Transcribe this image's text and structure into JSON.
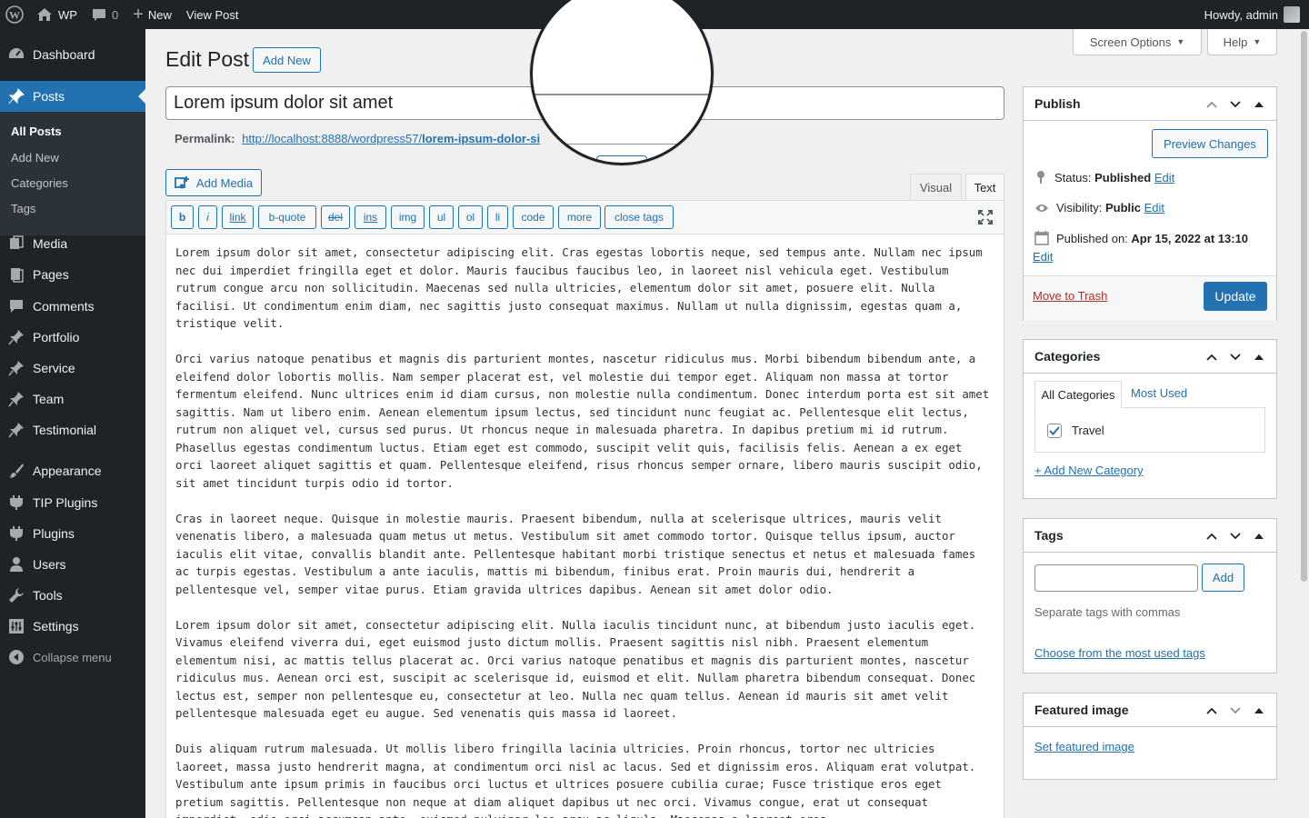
{
  "adminbar": {
    "site_name": "WP",
    "comments_count": "0",
    "new_label": "New",
    "view_post_label": "View Post",
    "howdy": "Howdy, admin"
  },
  "sidebar": {
    "items": [
      {
        "label": "Dashboard",
        "icon": "dashboard-icon"
      },
      {
        "label": "Posts",
        "icon": "pin-icon"
      },
      {
        "label": "Media",
        "icon": "media-icon"
      },
      {
        "label": "Pages",
        "icon": "pages-icon"
      },
      {
        "label": "Comments",
        "icon": "comments-icon"
      },
      {
        "label": "Portfolio",
        "icon": "pin-icon"
      },
      {
        "label": "Service",
        "icon": "pin-icon"
      },
      {
        "label": "Team",
        "icon": "pin-icon"
      },
      {
        "label": "Testimonial",
        "icon": "pin-icon"
      },
      {
        "label": "Appearance",
        "icon": "brush-icon"
      },
      {
        "label": "TIP Plugins",
        "icon": "plugin-icon"
      },
      {
        "label": "Plugins",
        "icon": "plugin-icon"
      },
      {
        "label": "Users",
        "icon": "users-icon"
      },
      {
        "label": "Tools",
        "icon": "tools-icon"
      },
      {
        "label": "Settings",
        "icon": "settings-icon"
      }
    ],
    "submenu": [
      "All Posts",
      "Add New",
      "Categories",
      "Tags"
    ],
    "collapse_label": "Collapse menu"
  },
  "header": {
    "screen_options": "Screen Options",
    "help": "Help",
    "page_title": "Edit Post",
    "add_new": "Add New"
  },
  "post": {
    "title": "Lorem ipsum dolor sit amet",
    "permalink_label": "Permalink:",
    "permalink_base": "http://localhost:8888/wordpress57/",
    "permalink_slug": "lorem-ipsum-dolor-si"
  },
  "editor": {
    "add_media": "Add Media",
    "tab_visual": "Visual",
    "tab_text": "Text",
    "quicktags": [
      "b",
      "i",
      "link",
      "b-quote",
      "del",
      "ins",
      "img",
      "ul",
      "ol",
      "li",
      "code",
      "more",
      "close tags"
    ],
    "paragraphs": [
      "Lorem ipsum dolor sit amet, consectetur adipiscing elit. Cras egestas lobortis neque, sed tempus ante. Nullam nec ipsum nec dui imperdiet fringilla eget et dolor. Mauris faucibus faucibus leo, in laoreet nisl vehicula eget. Vestibulum rutrum congue arcu non sollicitudin. Maecenas sed nulla ultricies, elementum dolor sit amet, posuere elit. Nulla facilisi. Ut condimentum enim diam, nec sagittis justo consequat maximus. Nullam ut nulla dignissim, egestas quam a, tristique velit.",
      "Orci varius natoque penatibus et magnis dis parturient montes, nascetur ridiculus mus. Morbi bibendum bibendum ante, a eleifend dolor lobortis mollis. Nam semper placerat est, vel molestie dui tempor eget. Aliquam non massa at tortor fermentum eleifend. Nunc ultrices enim id diam cursus, non molestie nulla condimentum. Donec interdum porta est sit amet sagittis. Nam ut libero enim. Aenean elementum ipsum lectus, sed tincidunt nunc feugiat ac. Pellentesque elit lectus, rutrum non aliquet vel, cursus sed purus. Ut rhoncus neque in malesuada pharetra. In dapibus pretium mi id rutrum. Phasellus egestas condimentum luctus. Etiam eget est commodo, suscipit velit quis, facilisis felis. Aenean a ex eget orci laoreet aliquet sagittis et quam. Pellentesque eleifend, risus rhoncus semper ornare, libero mauris suscipit odio, sit amet tincidunt turpis odio id tortor.",
      "Cras in laoreet neque. Quisque in molestie mauris. Praesent bibendum, nulla at scelerisque ultrices, mauris velit venenatis libero, a malesuada quam metus ut metus. Vestibulum sit amet commodo tortor. Quisque tellus ipsum, auctor iaculis elit vitae, convallis blandit ante. Pellentesque habitant morbi tristique senectus et netus et malesuada fames ac turpis egestas. Vestibulum a ante iaculis, mattis mi bibendum, finibus erat. Proin mauris dui, hendrerit a pellentesque vel, semper vitae purus. Etiam gravida ultrices dapibus. Aenean sit amet dolor odio.",
      "Lorem ipsum dolor sit amet, consectetur adipiscing elit. Nulla iaculis tincidunt nunc, at bibendum justo iaculis eget. Vivamus eleifend viverra dui, eget euismod justo dictum mollis. Praesent sagittis nisl nibh. Praesent elementum elementum nisi, ac mattis tellus placerat ac. Orci varius natoque penatibus et magnis dis parturient montes, nascetur ridiculus mus. Aenean orci est, suscipit ac scelerisque id, euismod et elit. Nullam pharetra bibendum consequat. Donec lectus est, semper non pellentesque eu, consectetur at leo. Nulla nec quam tellus. Aenean id mauris sit amet velit pellentesque malesuada eget eu augue. Sed venenatis quis massa id laoreet.",
      "Duis aliquam rutrum malesuada. Ut mollis libero fringilla lacinia ultricies. Proin rhoncus, tortor nec ultricies laoreet, massa justo hendrerit magna, at condimentum orci nisl ac lacus. Sed et dignissim eros. Aliquam erat volutpat. Vestibulum ante ipsum primis in faucibus orci luctus et ultrices posuere cubilia curae; Fusce tristique eros eget pretium sagittis. Pellentesque non neque at diam aliquet dapibus ut nec orci. Vivamus congue, erat ut consequat imperdiet, odio orci accumsan ante, euismod pulvinar leo arcu ac ligula. Maecenas a laoreet eros."
    ]
  },
  "publish": {
    "title": "Publish",
    "preview": "Preview Changes",
    "status_label": "Status:",
    "status_value": "Published",
    "visibility_label": "Visibility:",
    "visibility_value": "Public",
    "published_label": "Published on:",
    "published_value": "Apr 15, 2022 at 13:10",
    "edit": "Edit",
    "trash": "Move to Trash",
    "update": "Update"
  },
  "categories": {
    "title": "Categories",
    "tab_all": "All Categories",
    "tab_most": "Most Used",
    "items": [
      {
        "label": "Travel",
        "checked": true
      }
    ],
    "add_new": "+ Add New Category"
  },
  "tags": {
    "title": "Tags",
    "add": "Add",
    "input_value": "",
    "hint": "Separate tags with commas",
    "choose": "Choose from the most used tags"
  },
  "featured": {
    "title": "Featured image",
    "set": "Set featured image"
  },
  "colors": {
    "accent": "#2271b1",
    "adminbar": "#1d2327",
    "danger": "#b32d2e"
  }
}
